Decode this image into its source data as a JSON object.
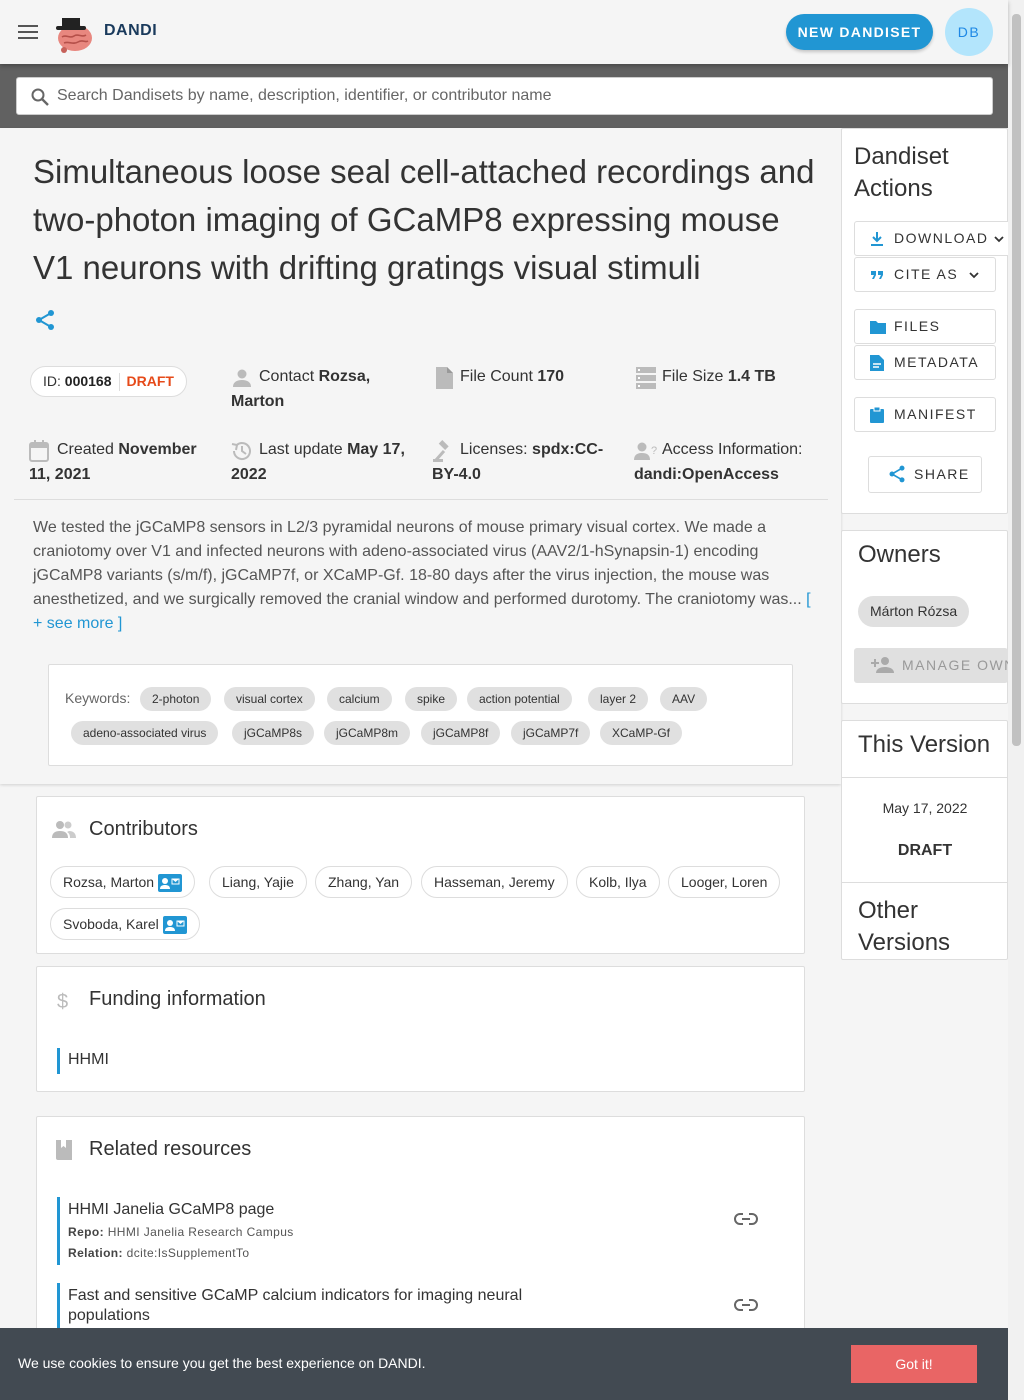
{
  "app": {
    "brand": "DANDI",
    "new_button": "NEW DANDISET",
    "avatar_initials": "DB"
  },
  "search": {
    "placeholder": "Search Dandisets by name, description, identifier, or contributor name"
  },
  "dandiset": {
    "title": "Simultaneous loose seal cell-attached recordings and two-photon imaging of GCaMP8 expressing mouse V1 neurons with drifting gratings visual stimuli",
    "id_label": "ID:",
    "id": "000168",
    "status": "DRAFT",
    "contact_label": "Contact",
    "contact": "Rozsa, Marton",
    "file_count_label": "File Count",
    "file_count": "170",
    "file_size_label": "File Size",
    "file_size": "1.4 TB",
    "created_label": "Created",
    "created": "November 11, 2021",
    "updated_label": "Last update",
    "updated": "May 17, 2022",
    "license_label": "Licenses:",
    "license": "spdx:CC-BY-4.0",
    "access_label": "Access Information:",
    "access": "dandi:OpenAccess",
    "description": "We tested the jGCaMP8 sensors in L2/3 pyramidal neurons of mouse primary visual cortex. We made a craniotomy over V1 and infected neurons with adeno-associated virus (AAV2/1-hSynapsin-1) encoding jGCaMP8 variants (s/m/f), jGCaMP7f, or XCaMP-Gf. 18-80 days after the virus injection, the mouse was anesthetized, and we surgically removed the cranial window and performed durotomy. The craniotomy was...",
    "see_more": "[ + see more ]",
    "keywords_label": "Keywords:",
    "keywords": [
      "2-photon",
      "visual cortex",
      "calcium",
      "spike",
      "action potential",
      "layer 2",
      "AAV",
      "adeno-associated virus",
      "jGCaMP8s",
      "jGCaMP8m",
      "jGCaMP8f",
      "jGCaMP7f",
      "XCaMP-Gf"
    ]
  },
  "contributors": {
    "heading": "Contributors",
    "people": [
      "Rozsa, Marton",
      "Liang, Yajie",
      "Zhang, Yan",
      "Hasseman, Jeremy",
      "Kolb, Ilya",
      "Looger, Loren",
      "Svoboda, Karel"
    ]
  },
  "funding": {
    "heading": "Funding information",
    "items": [
      "HHMI"
    ]
  },
  "related": {
    "heading": "Related resources",
    "items": [
      {
        "title": "HHMI Janelia GCaMP8 page",
        "repo_label": "Repo:",
        "repo": "HHMI Janelia Research Campus",
        "relation_label": "Relation:",
        "relation": "dcite:IsSupplementTo"
      },
      {
        "title": "Fast and sensitive GCaMP calcium indicators for imaging neural populations"
      }
    ]
  },
  "actions": {
    "heading": "Dandiset Actions",
    "download": "DOWNLOAD",
    "cite": "CITE AS",
    "files": "FILES",
    "metadata": "METADATA",
    "manifest": "MANIFEST",
    "share": "SHARE"
  },
  "owners": {
    "heading": "Owners",
    "names": [
      "Márton Rózsa"
    ],
    "manage": "MANAGE OWNERS"
  },
  "this_version": {
    "heading": "This Version",
    "date": "May 17, 2022",
    "label": "DRAFT"
  },
  "other_versions": {
    "heading": "Other Versions"
  },
  "cookie": {
    "text": "We use cookies to ensure you get the best experience on DANDI.",
    "button": "Got it!"
  },
  "colors": {
    "accent": "#2196d3",
    "draft": "#e64a19",
    "cookie_bg": "#424a52",
    "cookie_btn": "#e96565"
  }
}
